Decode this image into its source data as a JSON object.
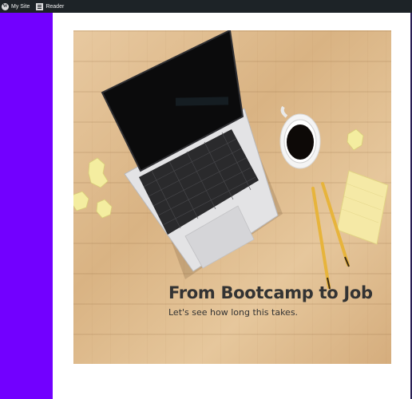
{
  "admin_bar": {
    "items": [
      {
        "label": "My Site",
        "icon": "wordpress-logo-icon"
      },
      {
        "label": "Reader",
        "icon": "reader-icon"
      }
    ]
  },
  "hero": {
    "title": "From Bootcamp to Job",
    "subtitle": "Let's see how long this takes.",
    "image": "laptop-coffee-desk-photo"
  },
  "colors": {
    "admin_bar": "#1d2327",
    "side_panel": "#7200ff",
    "text": "#333333"
  }
}
